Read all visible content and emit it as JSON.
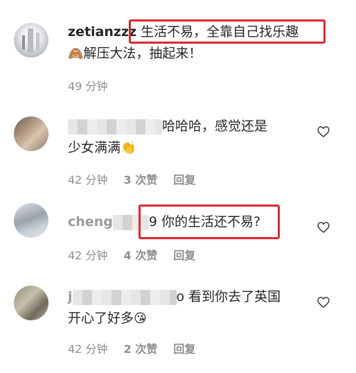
{
  "comments": [
    {
      "username": "zetianzzz",
      "line1": "生活不易，全靠自己找乐趣",
      "emoji": "🙈",
      "line2": "解压大法，抽起来！",
      "time": "49 分钟"
    },
    {
      "username_suffix": "哈哈哈，感觉还是",
      "line2": "少女满满",
      "emoji": "👏",
      "time": "42 分钟",
      "likes": "3 次赞",
      "reply": "回复"
    },
    {
      "username_partial": "cheng",
      "text_tail": "9 你的生活还不易?",
      "time": "42 分钟",
      "likes": "4 次赞",
      "reply": "回复"
    },
    {
      "username_partial": "j",
      "text_tail": "o 看到你去了英国",
      "line2": "开心了好多",
      "emoji": "😘",
      "time": "42 分钟",
      "likes": "2 次赞",
      "reply": "回复"
    }
  ],
  "colors": {
    "highlight_box": "#e0262a",
    "meta_text": "#8e8e8e"
  }
}
